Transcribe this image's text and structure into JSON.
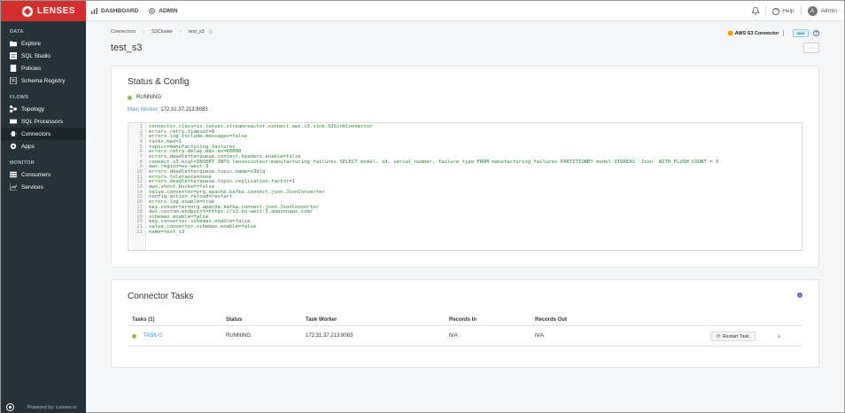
{
  "app": {
    "brand": "LENSES"
  },
  "topbar": {
    "dashboard": "DASHBOARD",
    "admin": "ADMIN",
    "help": "Help",
    "user": "Admin",
    "avatar_letter": "A"
  },
  "sidebar": {
    "sections": [
      {
        "title": "DATA",
        "items": [
          "Explore",
          "SQL Studio",
          "Policies",
          "Schema Registry"
        ]
      },
      {
        "title": "FLOWS",
        "items": [
          "Topology",
          "SQL Processors",
          "Connectors",
          "Apps"
        ]
      },
      {
        "title": "MONITOR",
        "items": [
          "Consumers",
          "Services"
        ]
      }
    ],
    "active": "Connectors",
    "powered_by": "Powered by: Lenses.io"
  },
  "breadcrumb": [
    "Connectors",
    "S3Cluster",
    "test_s3"
  ],
  "page": {
    "title": "test_s3",
    "connector_name": "AWS S3 Connector",
    "badge": "SINK",
    "more": "···"
  },
  "status_config": {
    "title": "Status & Config",
    "status": "RUNNING",
    "worker_label": "Main Worker:",
    "worker_value": "172.31.37.213:8083",
    "config_lines": [
      "connector.class=io.lenses.streamreactor.connect.aws.s3.sink.S3SinkConnector",
      "errors.retry.timeout=0",
      "errors.log.include.messages=false",
      "tasks.max=1",
      "topics=manufacturing_failures",
      "errors.retry.delay.max.ms=60000",
      "errors.deadletterqueue.context.headers.enable=false",
      "connect.s3.kcql=INSERT INTO lensesiotest:manufacturing_failures SELECT model, id, serial_number, failure_type FROM manufacturing_failures PARTITIONBY model STOREAS `Json` WITH_FLUSH_COUNT = 3",
      "aws.region=eu-west-3",
      "errors.deadletterqueue.topic.name=s3dlq",
      "errors.tolerance=none",
      "errors.deadletterqueue.topic.replication.factor=1",
      "aws.vhost.bucket=false",
      "value.converter=org.apache.kafka.connect.json.JsonConverter",
      "config.action.reload=restart",
      "errors.log.enable=true",
      "key.converter=org.apache.kafka.connect.json.JsonConverter",
      "aws.custom.endpoint=https://s3.eu-west-3.amazonaws.com/",
      "schemas.enable=false",
      "key.converter.schemas.enable=false",
      "value.converter.schemas.enable=false",
      "name=test_s3"
    ]
  },
  "tasks": {
    "title": "Connector Tasks",
    "help": "?",
    "columns": [
      "Tasks (1)",
      "Status",
      "Task Worker",
      "Records In",
      "Records Out"
    ],
    "rows": [
      {
        "task": "TASK-0",
        "status": "RUNNING",
        "worker": "172.31.37.213:8083",
        "records_in": "N/A",
        "records_out": "N/A"
      }
    ],
    "restart_label": "Restart Task"
  },
  "colors": {
    "brand": "#d32f2f",
    "sidebar": "#263238",
    "running": "#8bc34a",
    "link": "#1e88e5"
  }
}
